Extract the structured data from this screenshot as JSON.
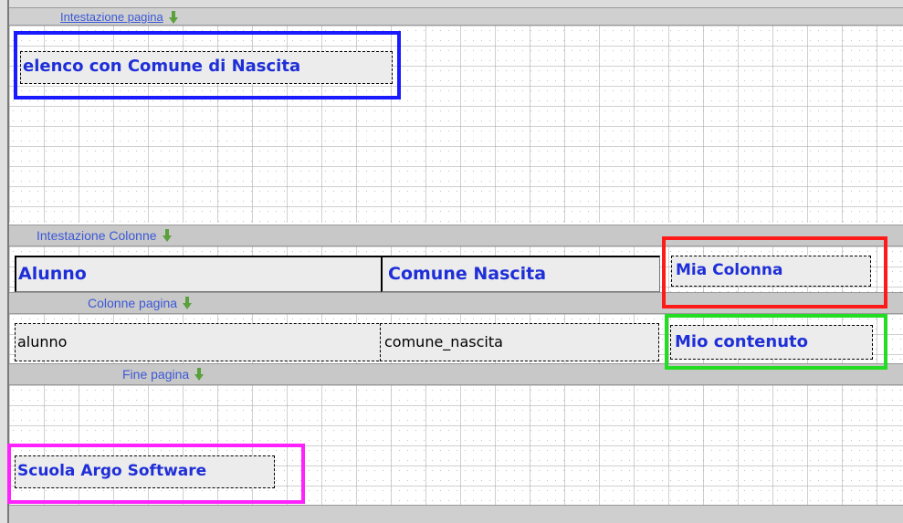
{
  "bands": {
    "page_header": "Intestazione pagina",
    "column_header": "Intestazione Colonne",
    "page_columns": "Colonne pagina",
    "page_footer": "Fine pagina"
  },
  "fields": {
    "report_title": "elenco con Comune di Nascita",
    "header_alunno": "Alunno",
    "header_comune": "Comune Nascita",
    "header_mia_colonna": "Mia Colonna",
    "detail_alunno": "alunno",
    "detail_comune": "comune_nascita",
    "detail_mio_contenuto": "Mio contenuto",
    "footer_school": "Scuola Argo Software"
  },
  "highlight_colors": {
    "title": "#1a1aff",
    "new_header": "#ff1a1a",
    "new_content": "#22dd22",
    "footer": "#ff22ff"
  },
  "icons": {
    "band_toggle": "green-down-arrow-icon"
  }
}
